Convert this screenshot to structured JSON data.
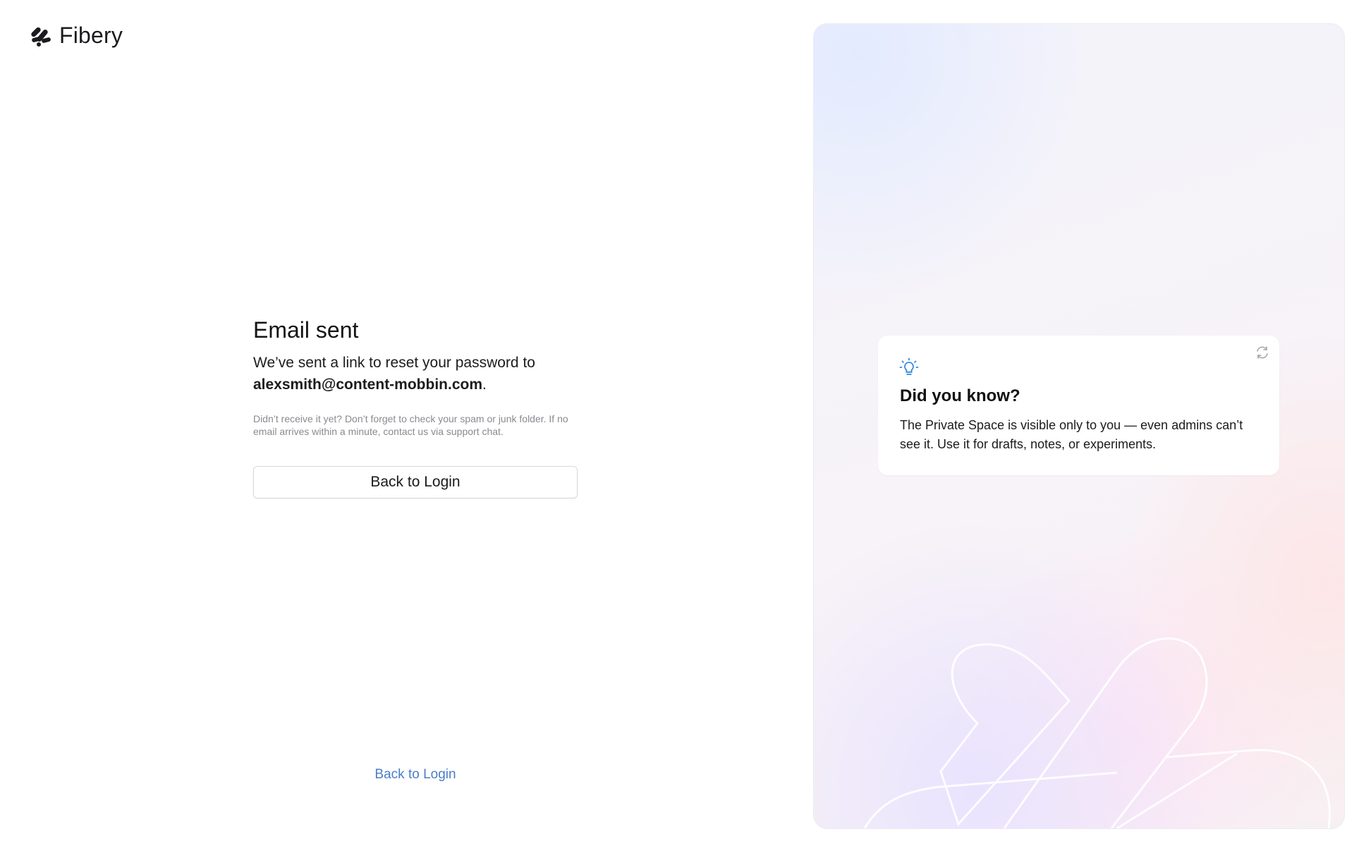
{
  "brand": {
    "name": "Fibery",
    "logo_icon": "fibery-logo-icon"
  },
  "main": {
    "title": "Email sent",
    "lead_prefix": "We’ve sent a link to reset your password to",
    "email": "alexsmith@content-mobbin.com",
    "lead_suffix": ".",
    "hint": "Didn’t receive it yet? Don’t forget to check your spam or junk folder. If no email arrives within a minute, contact us via support chat.",
    "back_button_label": "Back to Login"
  },
  "footer": {
    "back_link_label": "Back to Login",
    "link_color": "#4a7dc9"
  },
  "tip": {
    "icon": "lightbulb-icon",
    "icon_color": "#2f86e0",
    "refresh_icon": "refresh-icon",
    "title": "Did you know?",
    "body": "The Private Space is visible only to you — even admins can’t see it. Use it for drafts, notes, or experiments."
  }
}
